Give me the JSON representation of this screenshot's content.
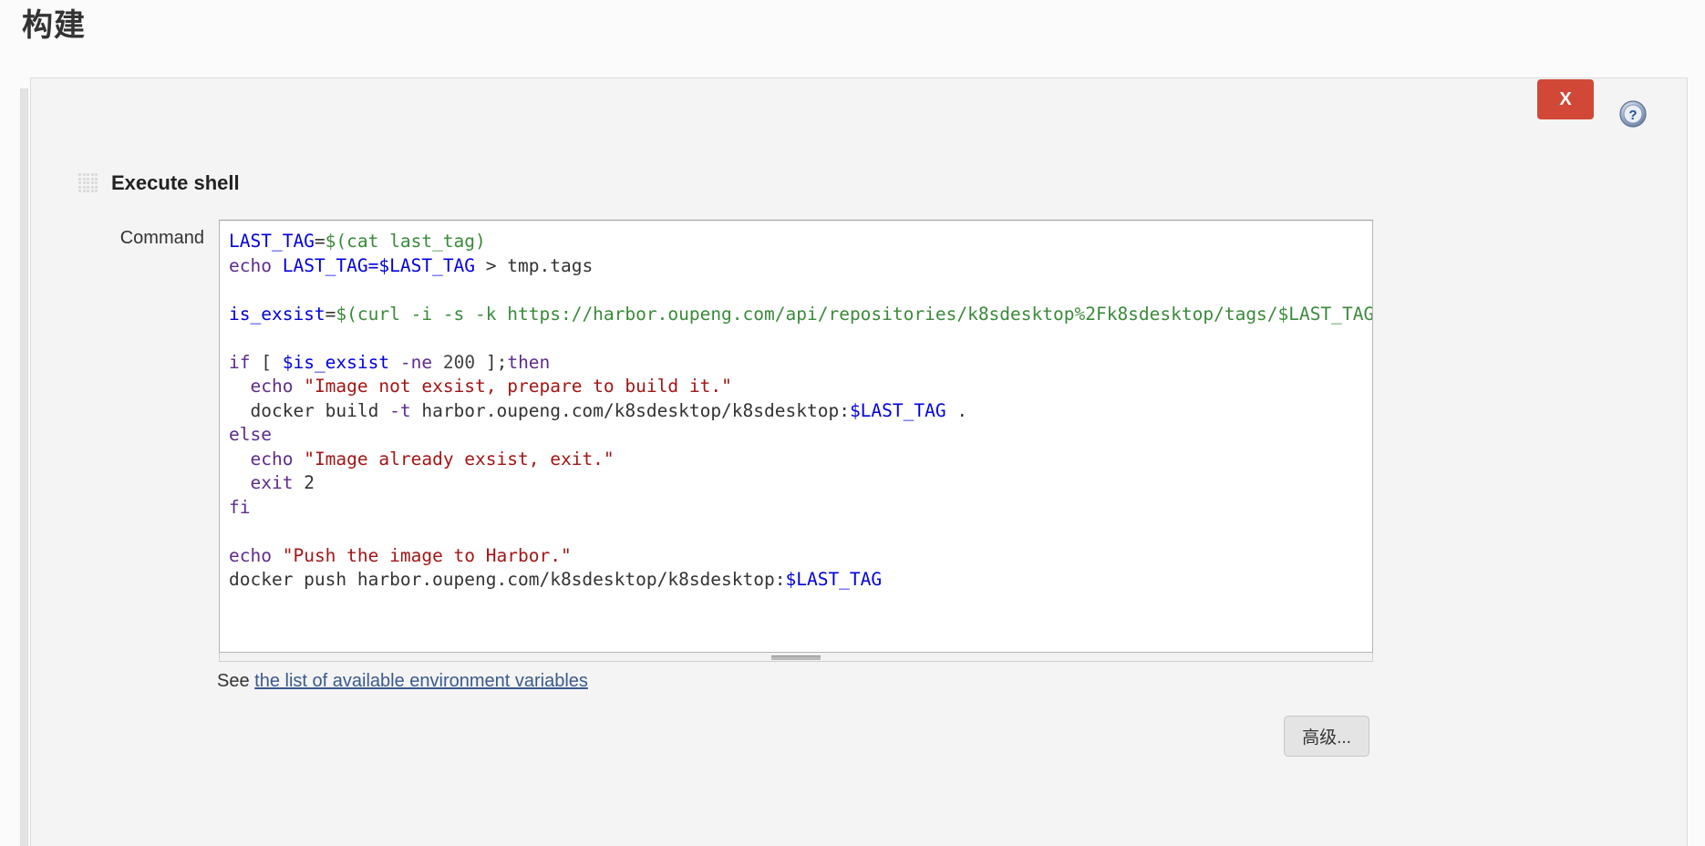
{
  "page": {
    "title": "构建"
  },
  "panel": {
    "section_title": "Execute shell",
    "drag_handle_icon": "grip-dots-icon",
    "close_label": "X",
    "help_icon": "help-circle-icon"
  },
  "command": {
    "label": "Command",
    "code_lines": [
      [
        {
          "t": "LAST_TAG",
          "c": "var"
        },
        {
          "t": "=",
          "c": "plain"
        },
        {
          "t": "$(cat last_tag)",
          "c": "subst"
        }
      ],
      [
        {
          "t": "echo",
          "c": "kw"
        },
        {
          "t": " ",
          "c": "plain"
        },
        {
          "t": "LAST_TAG=$LAST_TAG",
          "c": "var"
        },
        {
          "t": " > tmp.tags",
          "c": "plain"
        }
      ],
      [],
      [
        {
          "t": "is_exsist",
          "c": "var"
        },
        {
          "t": "=",
          "c": "plain"
        },
        {
          "t": "$(curl -i -s -k https://harbor.oupeng.com/api/repositories/k8sdesktop%2Fk8sdesktop/tags/$LAST_TAG -w %{http_code} -o /dev/null)",
          "c": "subst"
        }
      ],
      [],
      [
        {
          "t": "if",
          "c": "kw"
        },
        {
          "t": " [ ",
          "c": "plain"
        },
        {
          "t": "$is_exsist",
          "c": "var"
        },
        {
          "t": " ",
          "c": "plain"
        },
        {
          "t": "-ne",
          "c": "kw"
        },
        {
          "t": " ",
          "c": "plain"
        },
        {
          "t": "200",
          "c": "num"
        },
        {
          "t": " ];",
          "c": "plain"
        },
        {
          "t": "then",
          "c": "kw"
        }
      ],
      [
        {
          "t": "  ",
          "c": "plain"
        },
        {
          "t": "echo",
          "c": "kw"
        },
        {
          "t": " ",
          "c": "plain"
        },
        {
          "t": "\"Image not exsist, prepare to build it.\"",
          "c": "str"
        }
      ],
      [
        {
          "t": "  docker build ",
          "c": "plain"
        },
        {
          "t": "-t",
          "c": "kw"
        },
        {
          "t": " harbor.oupeng.com/k8sdesktop/k8sdesktop:",
          "c": "plain"
        },
        {
          "t": "$LAST_TAG",
          "c": "var"
        },
        {
          "t": " .",
          "c": "plain"
        }
      ],
      [
        {
          "t": "else",
          "c": "kw"
        }
      ],
      [
        {
          "t": "  ",
          "c": "plain"
        },
        {
          "t": "echo",
          "c": "kw"
        },
        {
          "t": " ",
          "c": "plain"
        },
        {
          "t": "\"Image already exsist, exit.\"",
          "c": "str"
        }
      ],
      [
        {
          "t": "  ",
          "c": "plain"
        },
        {
          "t": "exit",
          "c": "kw"
        },
        {
          "t": " 2",
          "c": "plain"
        }
      ],
      [
        {
          "t": "fi",
          "c": "kw"
        }
      ],
      [],
      [
        {
          "t": "echo",
          "c": "kw"
        },
        {
          "t": " ",
          "c": "plain"
        },
        {
          "t": "\"Push the image to Harbor.\"",
          "c": "str"
        }
      ],
      [
        {
          "t": "docker push harbor.oupeng.com/k8sdesktop/k8sdesktop:",
          "c": "plain"
        },
        {
          "t": "$LAST_TAG",
          "c": "var"
        }
      ]
    ],
    "resize_handle_icon": "horizontal-resize-grip-icon"
  },
  "footer": {
    "see_prefix": "See ",
    "env_link_label": "the list of available environment variables",
    "advanced_label": "高级..."
  },
  "colors": {
    "close_button_bg": "#d14836",
    "link": "#3a5a8c",
    "code_variable": "#0000e0",
    "code_substitution": "#3a8a3a",
    "code_keyword": "#5d2b8c",
    "code_string": "#a31515",
    "panel_bg": "#f4f4f4"
  }
}
